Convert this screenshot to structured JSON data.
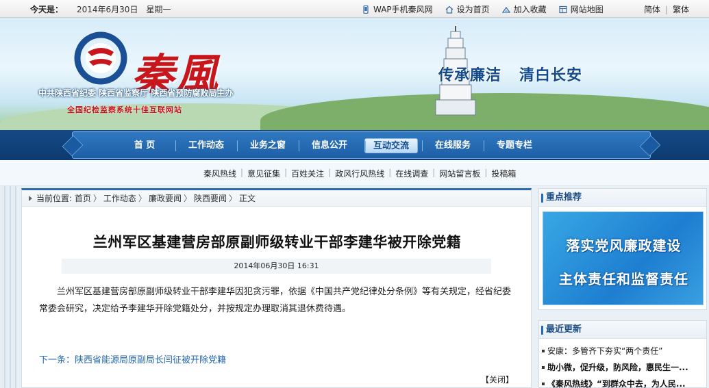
{
  "topbar": {
    "today_label": "今天是：",
    "date": "2014年6月30日　星期一",
    "links": [
      {
        "label": "WAP手机秦风网",
        "icon": "phone-icon"
      },
      {
        "label": "设为首页",
        "icon": "home-icon"
      },
      {
        "label": "加入收藏",
        "icon": "bookmark-icon"
      },
      {
        "label": "网站地图",
        "icon": "sitemap-icon"
      }
    ],
    "lang_simplified": "简体",
    "lang_traditional": "繁体"
  },
  "banner": {
    "logo_text": "秦風",
    "org": "中共陕西省纪委  陕西省监察厅  陕西省预防腐败局主办",
    "org2": "全国纪检监察系统十佳互联网站",
    "slogan_left": "传承廉洁",
    "slogan_right": "清白长安"
  },
  "nav": {
    "items": [
      "首 页",
      "工作动态",
      "业务之窗",
      "信息公开",
      "互动交流",
      "在线服务",
      "专题专栏"
    ],
    "active": "互动交流"
  },
  "subnav": {
    "items": [
      "秦风热线",
      "意见征集",
      "百姓关注",
      "政风行风热线",
      "在线调查",
      "网站留言板",
      "投稿箱"
    ]
  },
  "breadcrumb": {
    "prefix": "当前位置:",
    "items": [
      "首页",
      "工作动态",
      "廉政要闻",
      "陕西要闻",
      "正文"
    ]
  },
  "article": {
    "title": "兰州军区基建营房部原副师级转业干部李建华被开除党籍",
    "datetime": "2014年06月30日  16:31",
    "body": "兰州军区基建营房部原副师级转业干部李建华因犯贪污罪，依据《中国共产党纪律处分条例》等有关规定，经省纪委常委会研究，决定给予李建华开除党籍处分，并按规定办理取消其退休费待遇。",
    "next": "下一条：陕西省能源局原副局长闫征被开除党籍",
    "close": "【关闭】"
  },
  "sidebar": {
    "featured_title": "重点推荐",
    "promo_line1": "落实党风廉政建设",
    "promo_line2": "主体责任和监督责任",
    "latest_title": "最近更新",
    "latest": [
      "安康：多管齐下夯实“两个责任”",
      "助小微，促升级，防风险，惠民生一...",
      "《秦风热线》“到群众中去，为人民..."
    ]
  }
}
